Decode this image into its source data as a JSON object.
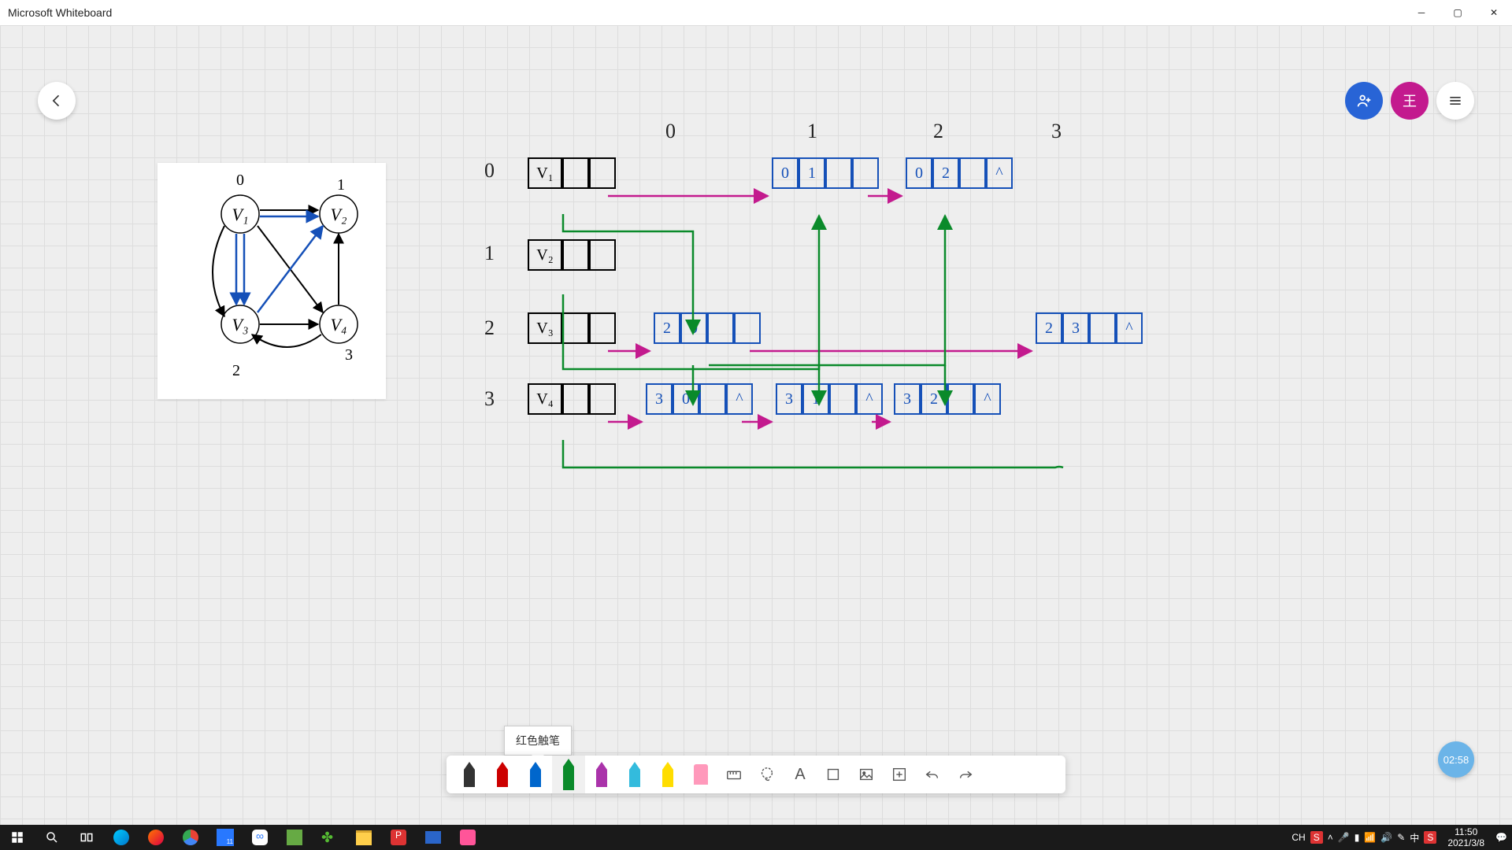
{
  "window": {
    "title": "Microsoft Whiteboard"
  },
  "avatars": {
    "user": "王"
  },
  "timer": "02:58",
  "tooltip": "红色触笔",
  "columns": [
    "0",
    "1",
    "2",
    "3"
  ],
  "rows": [
    {
      "label": "0",
      "head": "V₁",
      "nodes": [
        [
          "0",
          "1",
          ""
        ],
        [
          "0",
          "2",
          "^"
        ]
      ]
    },
    {
      "label": "1",
      "head": "V₂",
      "nodes": []
    },
    {
      "label": "2",
      "head": "V₃",
      "nodes": [
        [
          "2",
          "0",
          ""
        ],
        [
          "2",
          "3",
          "^"
        ]
      ]
    },
    {
      "label": "3",
      "head": "V₄",
      "nodes": [
        [
          "3",
          "0",
          "^"
        ],
        [
          "3",
          "1",
          "^"
        ],
        [
          "3",
          "2",
          "^"
        ]
      ]
    }
  ],
  "graph": {
    "indices": [
      "0",
      "1",
      "2",
      "3"
    ],
    "vertices": [
      "V₁",
      "V₂",
      "V₃",
      "V₄"
    ]
  },
  "taskbar": {
    "ime": "CH",
    "ime2": "S",
    "lang": "中",
    "time": "11:50",
    "date": "2021/3/8"
  }
}
